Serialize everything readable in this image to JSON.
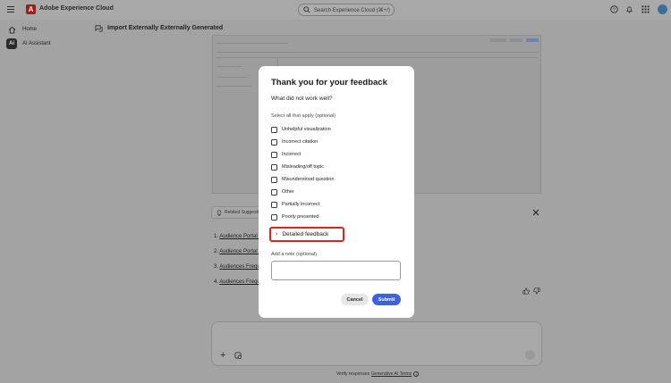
{
  "app": {
    "title": "Adobe Experience Cloud",
    "logo_letter": "A",
    "search_placeholder": "Search Experience Cloud (⌘+/)"
  },
  "topbar_icons": [
    "help-icon",
    "bell-icon",
    "apps-grid-icon",
    "avatar"
  ],
  "sidebar": {
    "items": [
      {
        "label": "Home",
        "icon": "home-icon"
      },
      {
        "label": "AI Assistant",
        "icon": "ai-assistant-icon"
      }
    ]
  },
  "page": {
    "title": "Import Externally Externally Generated"
  },
  "related": {
    "label": "Related Suggestions"
  },
  "suggestions": [
    {
      "num": "1.",
      "text": "Audience Portal C"
    },
    {
      "num": "2.",
      "text": "Audience Portal C"
    },
    {
      "num": "3.",
      "text": "Audiences Freque"
    },
    {
      "num": "4.",
      "text": "Audiences Freque"
    }
  ],
  "footer": {
    "prefix": "Verify responses",
    "link": "Generative AI Terms",
    "info": "i"
  },
  "modal": {
    "title": "Thank you for your feedback",
    "question": "What did not work well?",
    "select_hint": "Select all that apply (optional)",
    "options": [
      "Unhelpful visualization",
      "Incorrect citation",
      "Incorrect",
      "Misleading/off topic",
      "Misunderstood question",
      "Other",
      "Partially incorrect",
      "Poorly presented"
    ],
    "detailed_label": "Detailed feedback",
    "note_label": "Add a note (optional)",
    "note_value": "",
    "cancel_label": "Cancel",
    "submit_label": "Submit"
  },
  "colors": {
    "overlay_bg": "#a3a3a3",
    "brand_red": "#a81a12",
    "highlight_red": "#d7261e",
    "submit_blue": "#3b63e0"
  }
}
